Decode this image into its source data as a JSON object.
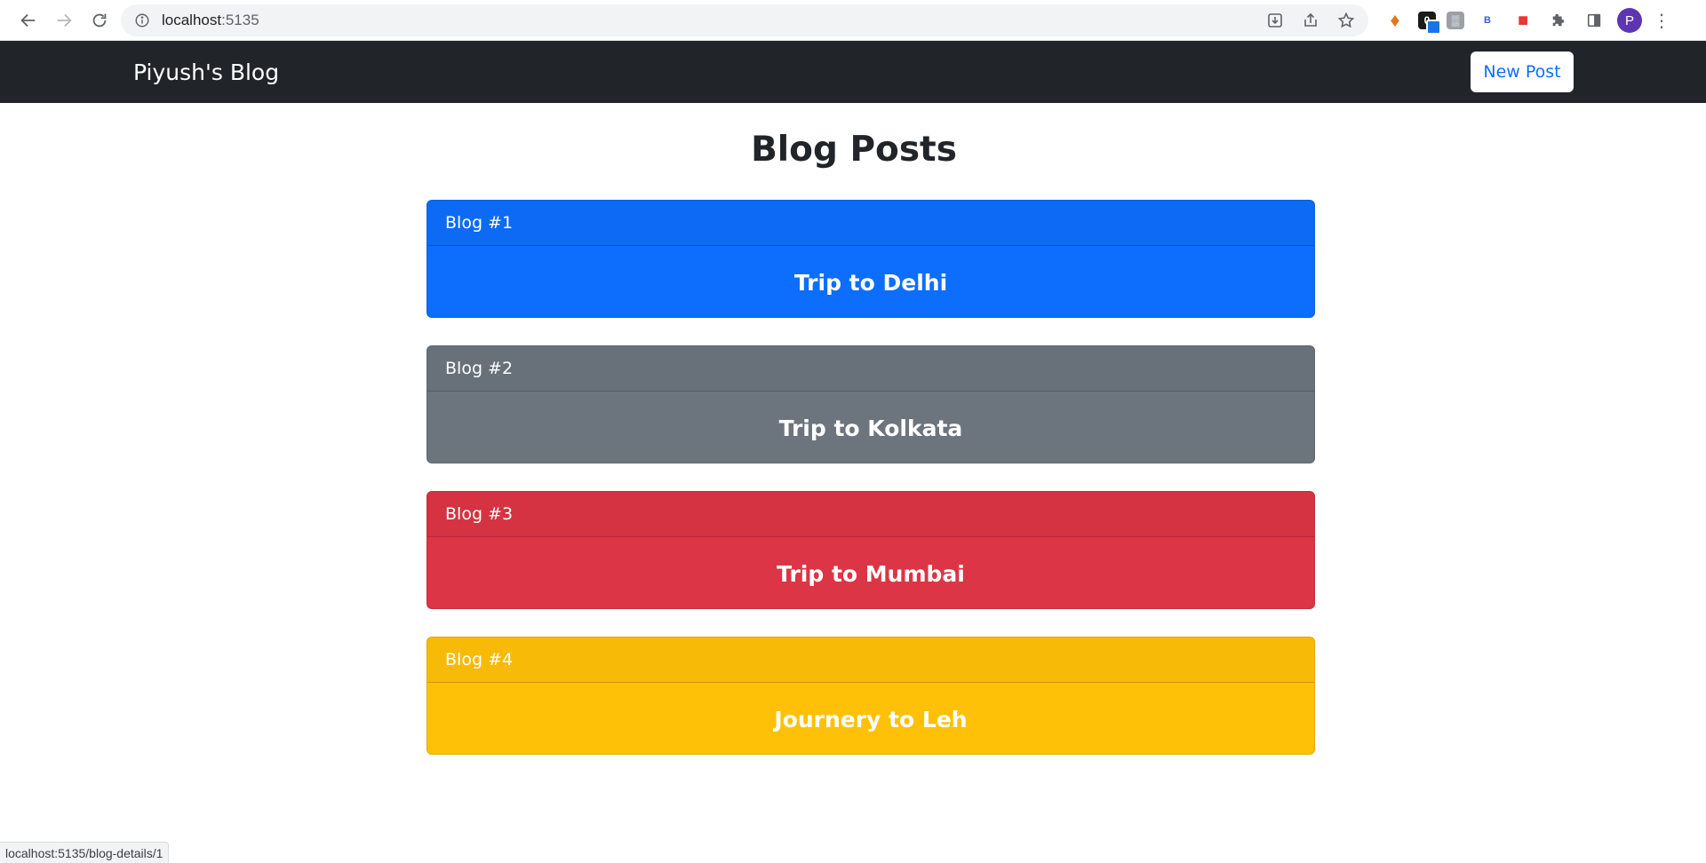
{
  "browser": {
    "url_host": "localhost",
    "url_port": ":5135",
    "status_url": "localhost:5135/blog-details/1",
    "avatar_letter": "P"
  },
  "navbar": {
    "brand": "Piyush's Blog",
    "new_post_label": "New Post",
    "background": "#212529"
  },
  "main": {
    "title": "Blog Posts",
    "posts": [
      {
        "header": "Blog #1",
        "title": "Trip to Delhi",
        "color": "#0d6efd"
      },
      {
        "header": "Blog #2",
        "title": "Trip to Kolkata",
        "color": "#6c757d"
      },
      {
        "header": "Blog #3",
        "title": "Trip to Mumbai",
        "color": "#dc3545"
      },
      {
        "header": "Blog #4",
        "title": "Journery to Leh",
        "color": "#ffc107"
      }
    ]
  },
  "icons": {
    "back": "arrow-left-icon",
    "forward": "arrow-right-icon",
    "reload": "reload-icon",
    "info": "info-icon",
    "install": "install-icon",
    "share": "share-icon",
    "bookmark": "star-icon",
    "extensions": "puzzle-icon",
    "side_panel": "side-panel-icon",
    "menu": "kebab-menu-icon"
  }
}
